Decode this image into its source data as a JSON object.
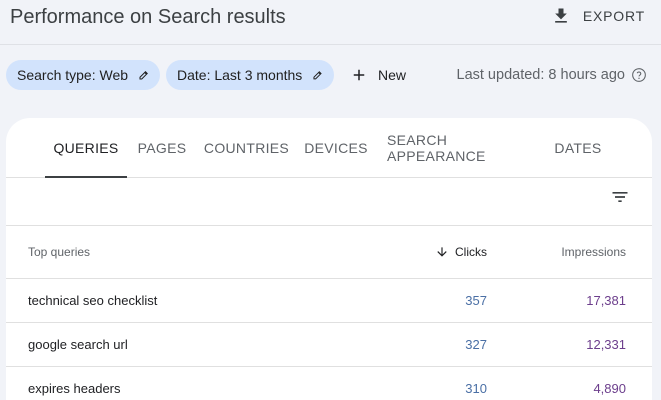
{
  "header": {
    "title": "Performance on Search results",
    "export_label": "EXPORT"
  },
  "filters": {
    "search_type": "Search type: Web",
    "date": "Date: Last 3 months",
    "new_label": "New",
    "last_updated": "Last updated: 8 hours ago"
  },
  "tabs": [
    "QUERIES",
    "PAGES",
    "COUNTRIES",
    "DEVICES",
    "SEARCH APPEARANCE",
    "DATES"
  ],
  "active_tab": "QUERIES",
  "table": {
    "columns": {
      "query": "Top queries",
      "clicks": "Clicks",
      "impressions": "Impressions"
    },
    "sort": "clicks-descending",
    "rows": [
      {
        "query": "technical seo checklist",
        "clicks": "357",
        "impressions": "17,381"
      },
      {
        "query": "google search url",
        "clicks": "327",
        "impressions": "12,331"
      },
      {
        "query": "expires headers",
        "clicks": "310",
        "impressions": "4,890"
      }
    ]
  },
  "colors": {
    "background": "#f1f3f8",
    "chip": "#d2e3fc",
    "clicks": "#4a6fa5",
    "impressions": "#6c3e8c"
  },
  "icons": [
    "download-icon",
    "pencil-icon",
    "plus-icon",
    "help-icon",
    "filter-list-icon",
    "arrow-down-icon"
  ]
}
